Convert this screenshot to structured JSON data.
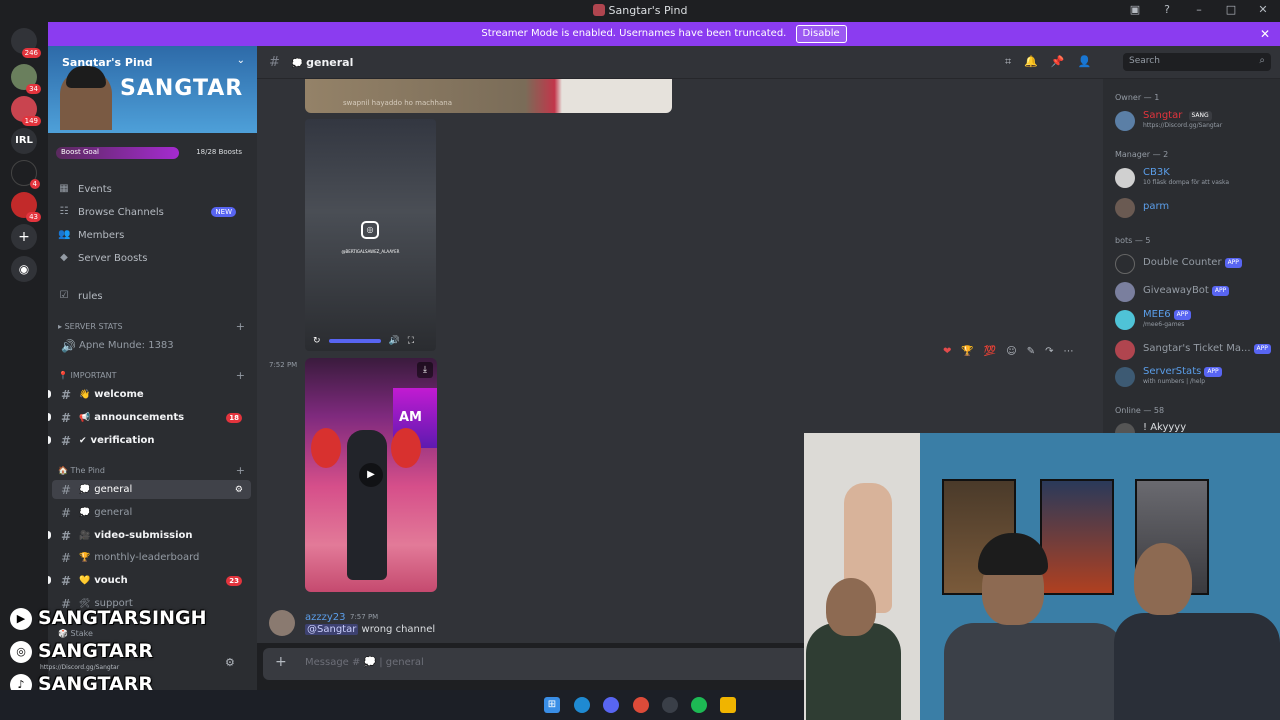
{
  "window": {
    "title": "Sangtar's Pind"
  },
  "banner": {
    "text": "Streamer Mode is enabled. Usernames have been truncated.",
    "disable": "Disable"
  },
  "guilds": [
    {
      "badge": "246"
    },
    {
      "badge": "34"
    },
    {
      "badge": "149"
    },
    {
      "label": "IRL"
    },
    {
      "badge": "4"
    },
    {
      "badge": "43"
    }
  ],
  "server": {
    "name": "Sangtar's Pind",
    "banner_text": "SANGTAR",
    "boost_label": "Boost Goal",
    "boost_count": "18/28 Boosts",
    "boost_progress": 0.64,
    "nav": [
      {
        "label": "Events"
      },
      {
        "label": "Browse Channels",
        "badge": "NEW"
      },
      {
        "label": "Members"
      },
      {
        "label": "Server Boosts"
      }
    ],
    "rules": "rules",
    "cat_stats": "SERVER STATS",
    "stat_channel": "Apne Munde: 1383",
    "cat_important": "IMPORTANT",
    "ch_welcome": "welcome",
    "ch_announcements": "announcements",
    "ch_announcements_badge": "18",
    "ch_verification": "verification",
    "cat_pind": "The Pind",
    "ch_general": "general",
    "ch_general2": "general",
    "ch_video": "video-submission",
    "ch_leader": "monthly-leaderboard",
    "ch_vouch": "vouch",
    "ch_vouch_badge": "23",
    "ch_support": "support",
    "cat_stake": "Stake"
  },
  "overlay": {
    "yt": "SANGTARSINGH",
    "ig": "SANGTARR",
    "tt": "SANGTARR",
    "link": "https://Discord.gg/Sangtar"
  },
  "channel": {
    "name": "general",
    "search_placeholder": "Search",
    "composer_prefix": "Message #",
    "composer_channel": "general"
  },
  "messages": {
    "media_caption": "swapnil hayaddo ho machhana",
    "video_caption": "@BERTIGALSAWEZ_ALAAYER",
    "video_time": "7:52 PM",
    "reply": {
      "user": "azzzy23",
      "time": "7:57 PM",
      "mention": "@Sangtar",
      "text": "wrong channel"
    }
  },
  "members": {
    "owner_cat": "Owner — 1",
    "owner": {
      "name": "Sangtar",
      "tag": "SANG",
      "status": "https://Discord.gg/Sangtar"
    },
    "manager_cat": "Manager — 2",
    "managers": [
      {
        "name": "CB3K",
        "status": "10 fläsk dompa för att vaska"
      },
      {
        "name": "parm",
        "status": ""
      }
    ],
    "bots_cat": "bots — 5",
    "bots": [
      {
        "name": "Double Counter",
        "tag": "APP",
        "status": ""
      },
      {
        "name": "GiveawayBot",
        "tag": "APP",
        "status": ""
      },
      {
        "name": "MEE6",
        "tag": "APP",
        "status": "/mee6-games"
      },
      {
        "name": "Sangtar's Ticket Ma...",
        "tag": "APP",
        "status": ""
      },
      {
        "name": "ServerStats",
        "tag": "APP",
        "status": "with numbers | /help"
      }
    ],
    "online_cat": "Online — 58",
    "online_first": "! Akyyyy"
  },
  "colors": {
    "accent": "#5865f2",
    "banner": "#8b3cf0",
    "mention_red": "#e3343d"
  }
}
